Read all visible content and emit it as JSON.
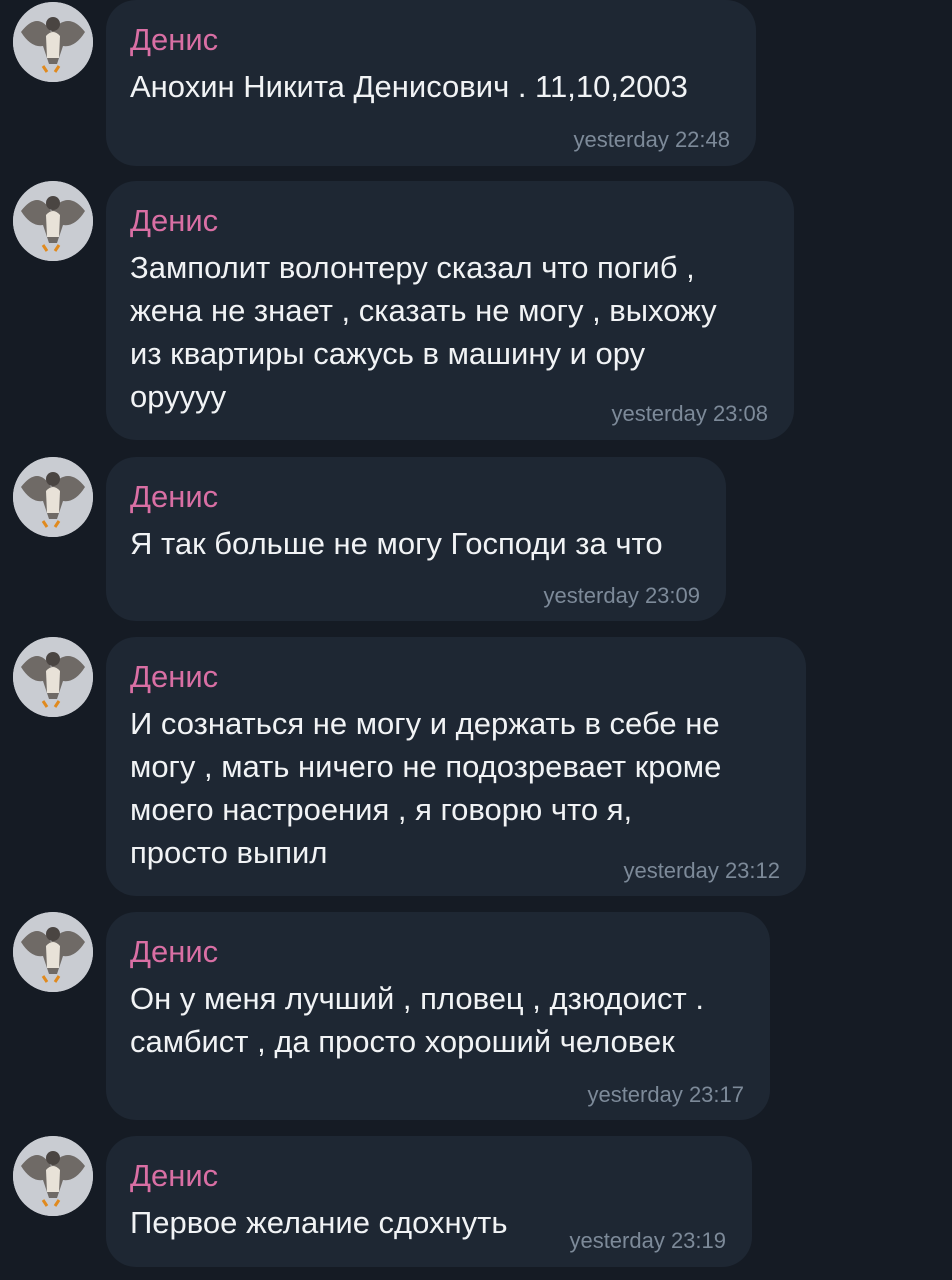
{
  "sender_name": "Денис",
  "messages": [
    {
      "lines": [
        "Анохин Никита Денисович . 11,10,2003"
      ],
      "time": "yesterday 22:48"
    },
    {
      "lines": [
        "Замполит волонтеру сказал что погиб ,",
        "жена не знает , сказать не могу , выхожу",
        "из квартиры сажусь в машину и ору",
        "оруууу"
      ],
      "time": "yesterday 23:08"
    },
    {
      "lines": [
        "Я так больше не могу Господи за что"
      ],
      "time": "yesterday 23:09"
    },
    {
      "lines": [
        "И сознаться не могу и держать в себе не",
        "могу , мать ничего не подозревает кроме",
        "моего настроения , я говорю что я,",
        "просто выпил"
      ],
      "time": "yesterday 23:12"
    },
    {
      "lines": [
        "Он у меня лучший , пловец , дзюдоист .",
        "самбист , да просто хороший человек"
      ],
      "time": "yesterday 23:17"
    },
    {
      "lines": [
        "Первое желание сдохнуть"
      ],
      "time": "yesterday 23:19"
    }
  ]
}
